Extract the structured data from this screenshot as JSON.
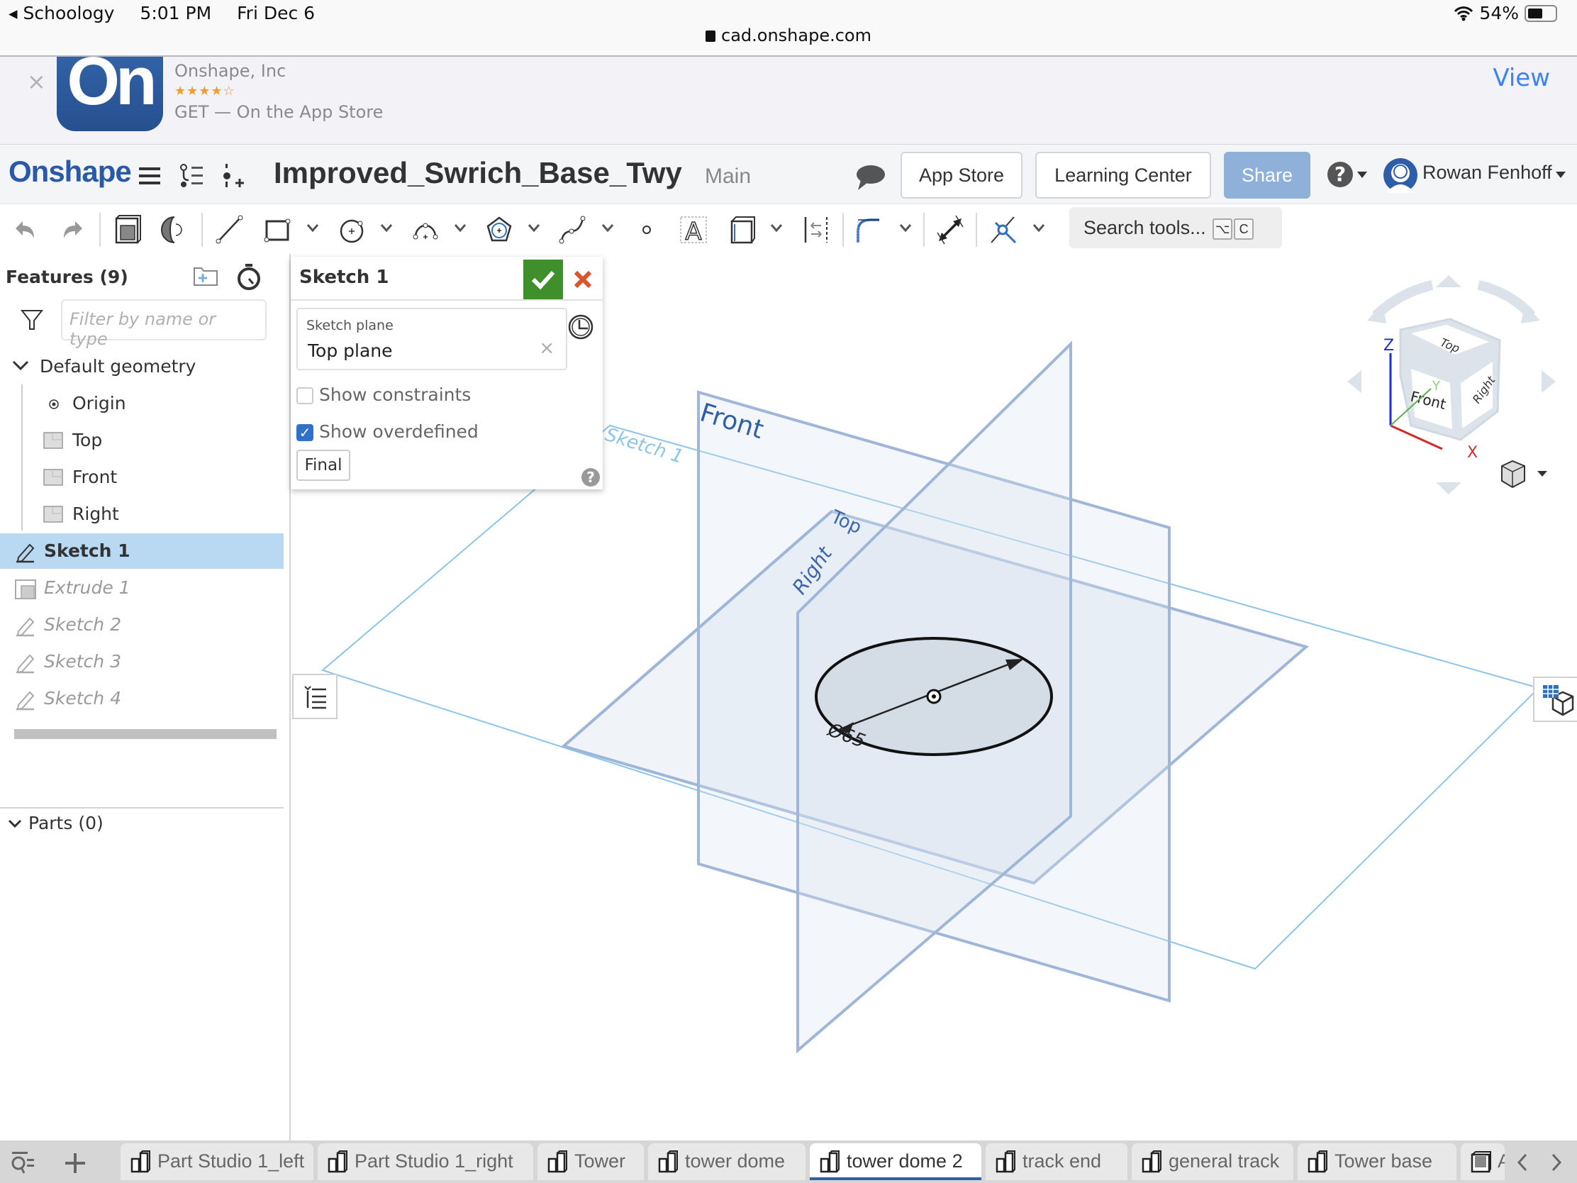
{
  "status_bar": {
    "back_app": "Schoology",
    "time": "5:01 PM",
    "date": "Fri Dec 6",
    "battery": "54%",
    "battery_level": 0.54,
    "url": "cad.onshape.com"
  },
  "app_banner": {
    "logo_text": "On",
    "company": "Onshape, Inc",
    "rating_stars": "★★★★☆",
    "rating": 3.5,
    "cta": "GET — On the App Store",
    "view_label": "View",
    "close_label": "×"
  },
  "header": {
    "brand": "Onshape",
    "document_title": "Improved_Swrich_Base_Twy",
    "branch": "Main",
    "buttons": {
      "app_store": "App Store",
      "learning_center": "Learning Center",
      "share": "Share"
    },
    "help_label": "?",
    "user_name": "Rowan Fenhoff"
  },
  "toolbar": {
    "search_placeholder": "Search tools...",
    "shortcut_keys": [
      "⌥",
      "C"
    ],
    "tools": [
      "undo",
      "redo",
      "extrude",
      "revolve",
      "line",
      "rectangle",
      "circle",
      "arc",
      "polygon",
      "spline",
      "point",
      "text",
      "construction",
      "mirror",
      "fillet",
      "dimension",
      "trim"
    ]
  },
  "feature_panel": {
    "title": "Features (9)",
    "filter_placeholder": "Filter by name or type",
    "default_geometry": "Default geometry",
    "geometry_items": [
      {
        "label": "Origin",
        "icon": "origin-icon"
      },
      {
        "label": "Top",
        "icon": "plane-icon"
      },
      {
        "label": "Front",
        "icon": "plane-icon"
      },
      {
        "label": "Right",
        "icon": "plane-icon"
      }
    ],
    "features": [
      {
        "label": "Sketch 1",
        "icon": "sketch-icon",
        "state": "selected"
      },
      {
        "label": "Extrude 1",
        "icon": "extrude-icon",
        "state": "rolled-back"
      },
      {
        "label": "Sketch 2",
        "icon": "sketch-icon",
        "state": "rolled-back"
      },
      {
        "label": "Sketch 3",
        "icon": "sketch-icon",
        "state": "rolled-back"
      },
      {
        "label": "Sketch 4",
        "icon": "sketch-icon",
        "state": "rolled-back"
      }
    ],
    "parts": "Parts (0)"
  },
  "sketch_dialog": {
    "title": "Sketch 1",
    "plane_label": "Sketch plane",
    "plane_value": "Top plane",
    "show_constraints": {
      "label": "Show constraints",
      "checked": false
    },
    "show_overdefined": {
      "label": "Show overdefined",
      "checked": true
    },
    "final_label": "Final",
    "help": "?"
  },
  "viewport": {
    "plane_labels": {
      "front": "Front",
      "top": "Top",
      "right": "Right",
      "sketch": "Sketch 1"
    },
    "dimension_label": "Ø65",
    "view_cube": {
      "top": "Top",
      "front": "Front",
      "right": "Right",
      "axes": [
        "X",
        "Y",
        "Z"
      ]
    },
    "colors": {
      "plane_edge": "#8eaad3",
      "plane_fill": "#e9eef5",
      "sketch_plane": "#8cc4ea",
      "axis_x": "#d22b2b",
      "axis_y": "#59b14a",
      "axis_z": "#1a2fc9"
    }
  },
  "tabs": [
    {
      "label": "Part Studio 1_left",
      "active": false
    },
    {
      "label": "Part Studio 1_right",
      "active": false
    },
    {
      "label": "Tower",
      "active": false
    },
    {
      "label": "tower dome",
      "active": false
    },
    {
      "label": "tower dome 2",
      "active": true
    },
    {
      "label": "track end",
      "active": false
    },
    {
      "label": "general track",
      "active": false
    },
    {
      "label": "Tower base",
      "active": false
    },
    {
      "label": "A",
      "active": false
    }
  ]
}
